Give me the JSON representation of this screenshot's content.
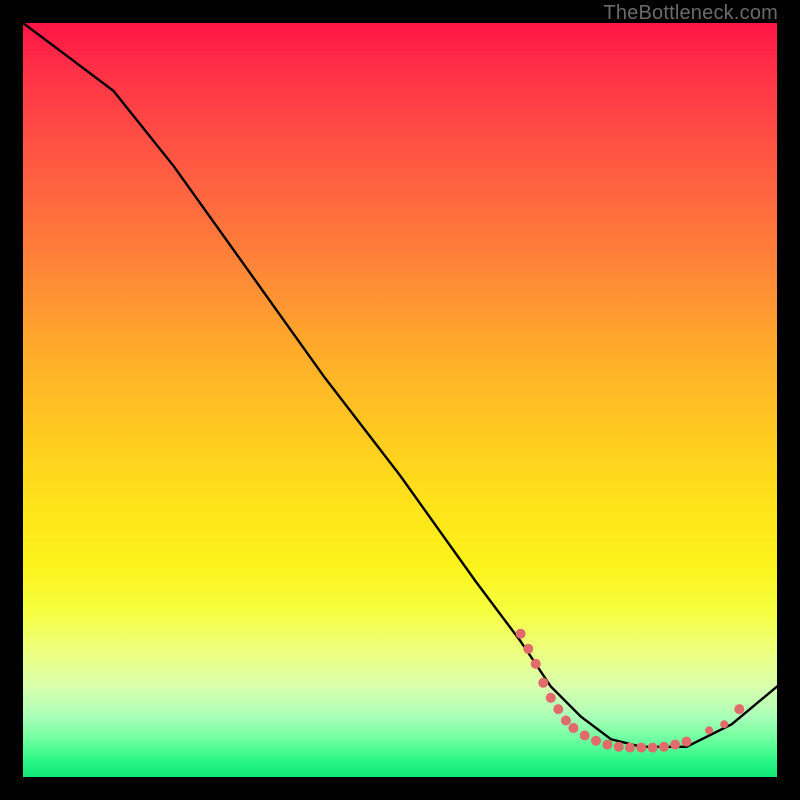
{
  "watermark": "TheBottleneck.com",
  "chart_data": {
    "type": "line",
    "title": "",
    "xlabel": "",
    "ylabel": "",
    "xlim": [
      0,
      100
    ],
    "ylim": [
      0,
      100
    ],
    "grid": false,
    "legend": false,
    "series": [
      {
        "name": "curve",
        "x": [
          0,
          4,
          8,
          12,
          20,
          30,
          40,
          50,
          60,
          66,
          70,
          74,
          78,
          82,
          86,
          88,
          90,
          94,
          100
        ],
        "y": [
          100,
          97,
          94,
          91,
          81,
          67,
          53,
          40,
          26,
          18,
          12,
          8,
          5,
          4,
          4,
          4,
          5,
          7,
          12
        ],
        "color": "#000000"
      }
    ],
    "markers": [
      {
        "x": 66.0,
        "y": 19.0,
        "r": 5
      },
      {
        "x": 67.0,
        "y": 17.0,
        "r": 5
      },
      {
        "x": 68.0,
        "y": 15.0,
        "r": 5
      },
      {
        "x": 69.0,
        "y": 12.5,
        "r": 5
      },
      {
        "x": 70.0,
        "y": 10.5,
        "r": 5
      },
      {
        "x": 71.0,
        "y": 9.0,
        "r": 5
      },
      {
        "x": 72.0,
        "y": 7.5,
        "r": 5
      },
      {
        "x": 73.0,
        "y": 6.5,
        "r": 5
      },
      {
        "x": 74.5,
        "y": 5.5,
        "r": 5
      },
      {
        "x": 76.0,
        "y": 4.8,
        "r": 5
      },
      {
        "x": 77.5,
        "y": 4.3,
        "r": 5
      },
      {
        "x": 79.0,
        "y": 4.0,
        "r": 5
      },
      {
        "x": 80.5,
        "y": 3.9,
        "r": 5
      },
      {
        "x": 82.0,
        "y": 3.9,
        "r": 5
      },
      {
        "x": 83.5,
        "y": 3.9,
        "r": 5
      },
      {
        "x": 85.0,
        "y": 4.0,
        "r": 5
      },
      {
        "x": 86.5,
        "y": 4.3,
        "r": 5
      },
      {
        "x": 88.0,
        "y": 4.7,
        "r": 5
      },
      {
        "x": 91.0,
        "y": 6.2,
        "r": 4
      },
      {
        "x": 93.0,
        "y": 7.0,
        "r": 4
      },
      {
        "x": 95.0,
        "y": 9.0,
        "r": 5
      }
    ],
    "marker_color": "#e26a6a"
  }
}
